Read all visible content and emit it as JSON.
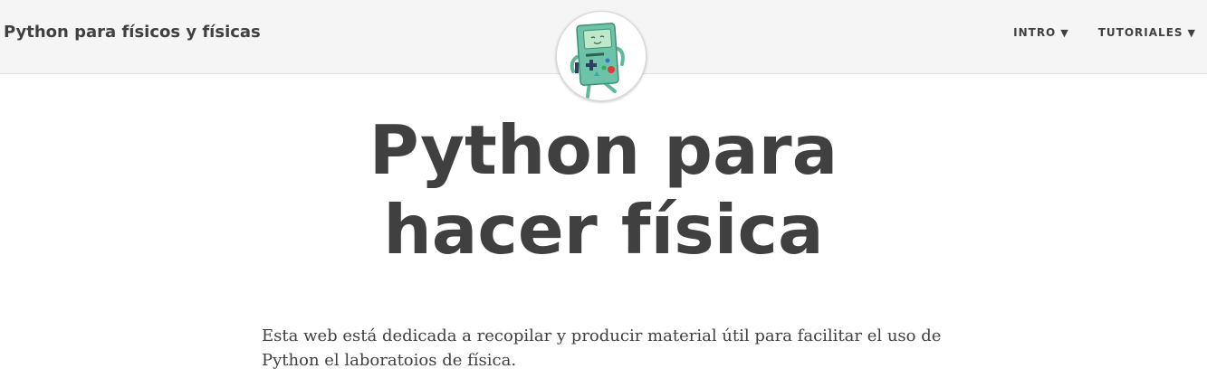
{
  "navbar": {
    "brand": "Python para físicos y físicas",
    "items": [
      {
        "label": "INTRO",
        "caret": "▼"
      },
      {
        "label": "TUTORIALES",
        "caret": "▼"
      }
    ],
    "avatar_icon": "bmo-robot-icon"
  },
  "header": {
    "title_line1": "Python para",
    "title_line2": "hacer física"
  },
  "main": {
    "intro": "Esta web está dedicada a recopilar y producir material útil para facilitar el uso de Python el laboratoios de física."
  },
  "colors": {
    "navbar_bg": "#f5f5f5",
    "text": "#404040",
    "robot_body": "#6cc3a8"
  }
}
